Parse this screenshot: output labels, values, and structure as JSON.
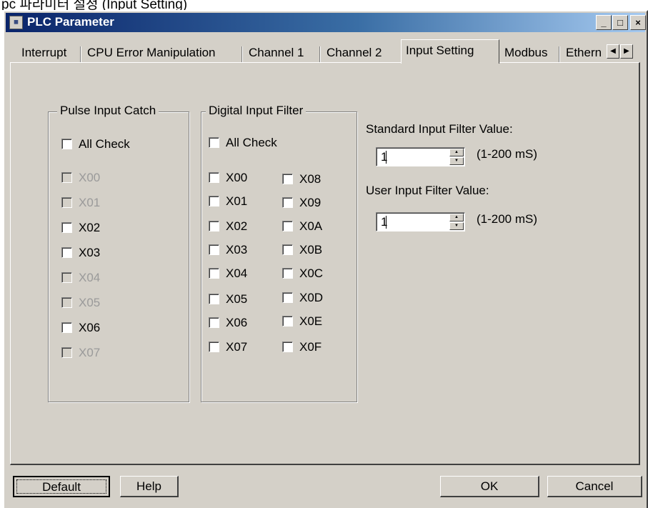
{
  "background_caption": "pc 파라미터 설정 (Input Setting)",
  "window": {
    "title": "PLC Parameter",
    "controls": [
      "_",
      "□",
      "×"
    ]
  },
  "tabs": [
    {
      "label": "Interrupt"
    },
    {
      "label": "CPU Error Manipulation"
    },
    {
      "label": "Channel 1"
    },
    {
      "label": "Channel 2"
    },
    {
      "label": "Input Setting",
      "active": true
    },
    {
      "label": "Modbus"
    },
    {
      "label": "Ethern"
    }
  ],
  "pulse_input_catch": {
    "title": "Pulse Input Catch",
    "all_check": "All Check",
    "items": [
      {
        "label": "X00",
        "enabled": false
      },
      {
        "label": "X01",
        "enabled": false
      },
      {
        "label": "X02",
        "enabled": true
      },
      {
        "label": "X03",
        "enabled": true
      },
      {
        "label": "X04",
        "enabled": false
      },
      {
        "label": "X05",
        "enabled": false
      },
      {
        "label": "X06",
        "enabled": true
      },
      {
        "label": "X07",
        "enabled": false
      }
    ]
  },
  "digital_input_filter": {
    "title": "Digital Input Filter",
    "all_check": "All Check",
    "left": [
      "X00",
      "X01",
      "X02",
      "X03",
      "X04",
      "X05",
      "X06",
      "X07"
    ],
    "right": [
      "X08",
      "X09",
      "X0A",
      "X0B",
      "X0C",
      "X0D",
      "X0E",
      "X0F"
    ]
  },
  "standard_filter": {
    "label": "Standard Input Filter Value:",
    "value": "1",
    "range": "(1-200 mS)"
  },
  "user_filter": {
    "label": "User Input Filter Value:",
    "value": "1",
    "range": "(1-200 mS)"
  },
  "buttons": {
    "default": "Default",
    "help": "Help",
    "ok": "OK",
    "cancel": "Cancel"
  },
  "icons": {
    "title_icon": "plc-app-icon",
    "scroll_left": "arrow-left-icon",
    "scroll_right": "arrow-right-icon"
  }
}
